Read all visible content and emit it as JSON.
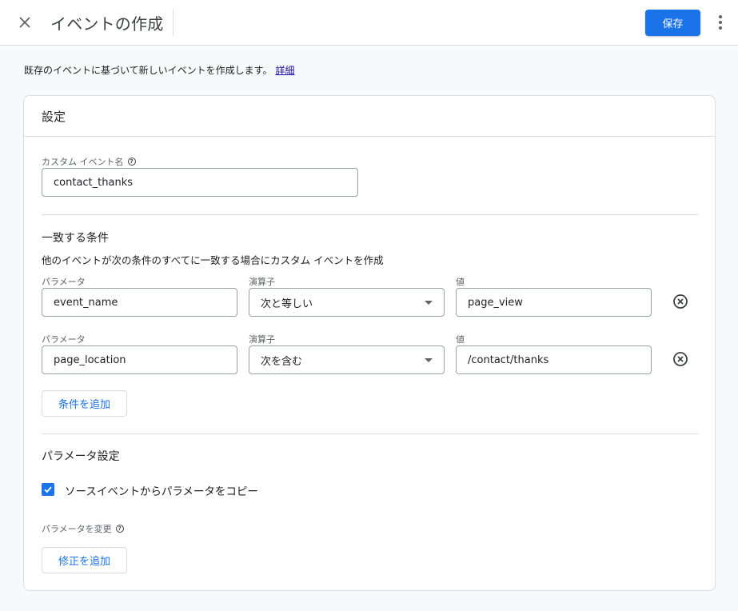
{
  "header": {
    "title": "イベントの作成",
    "save_label": "保存"
  },
  "intro": {
    "text": "既存のイベントに基づいて新しいイベントを作成します。",
    "link_label": "詳細"
  },
  "settings": {
    "card_title": "設定",
    "custom_event_label": "カスタム イベント名",
    "custom_event_value": "contact_thanks",
    "conditions_title": "一致する条件",
    "conditions_desc": "他のイベントが次の条件のすべてに一致する場合にカスタム イベントを作成",
    "conditions": [
      {
        "param_label": "パラメータ",
        "param_value": "event_name",
        "operator_label": "演算子",
        "operator_value": "次と等しい",
        "value_label": "値",
        "value_value": "page_view"
      },
      {
        "param_label": "パラメータ",
        "param_value": "page_location",
        "operator_label": "演算子",
        "operator_value": "次を含む",
        "value_label": "値",
        "value_value": "/contact/thanks"
      }
    ],
    "add_condition_label": "条件を追加",
    "param_settings_title": "パラメータ設定",
    "copy_params_label": "ソースイベントからパラメータをコピー",
    "copy_params_checked": true,
    "modify_params_label": "パラメータを変更",
    "add_modification_label": "修正を追加"
  },
  "colors": {
    "accent": "#1a73e8",
    "link": "#1a0dab"
  }
}
